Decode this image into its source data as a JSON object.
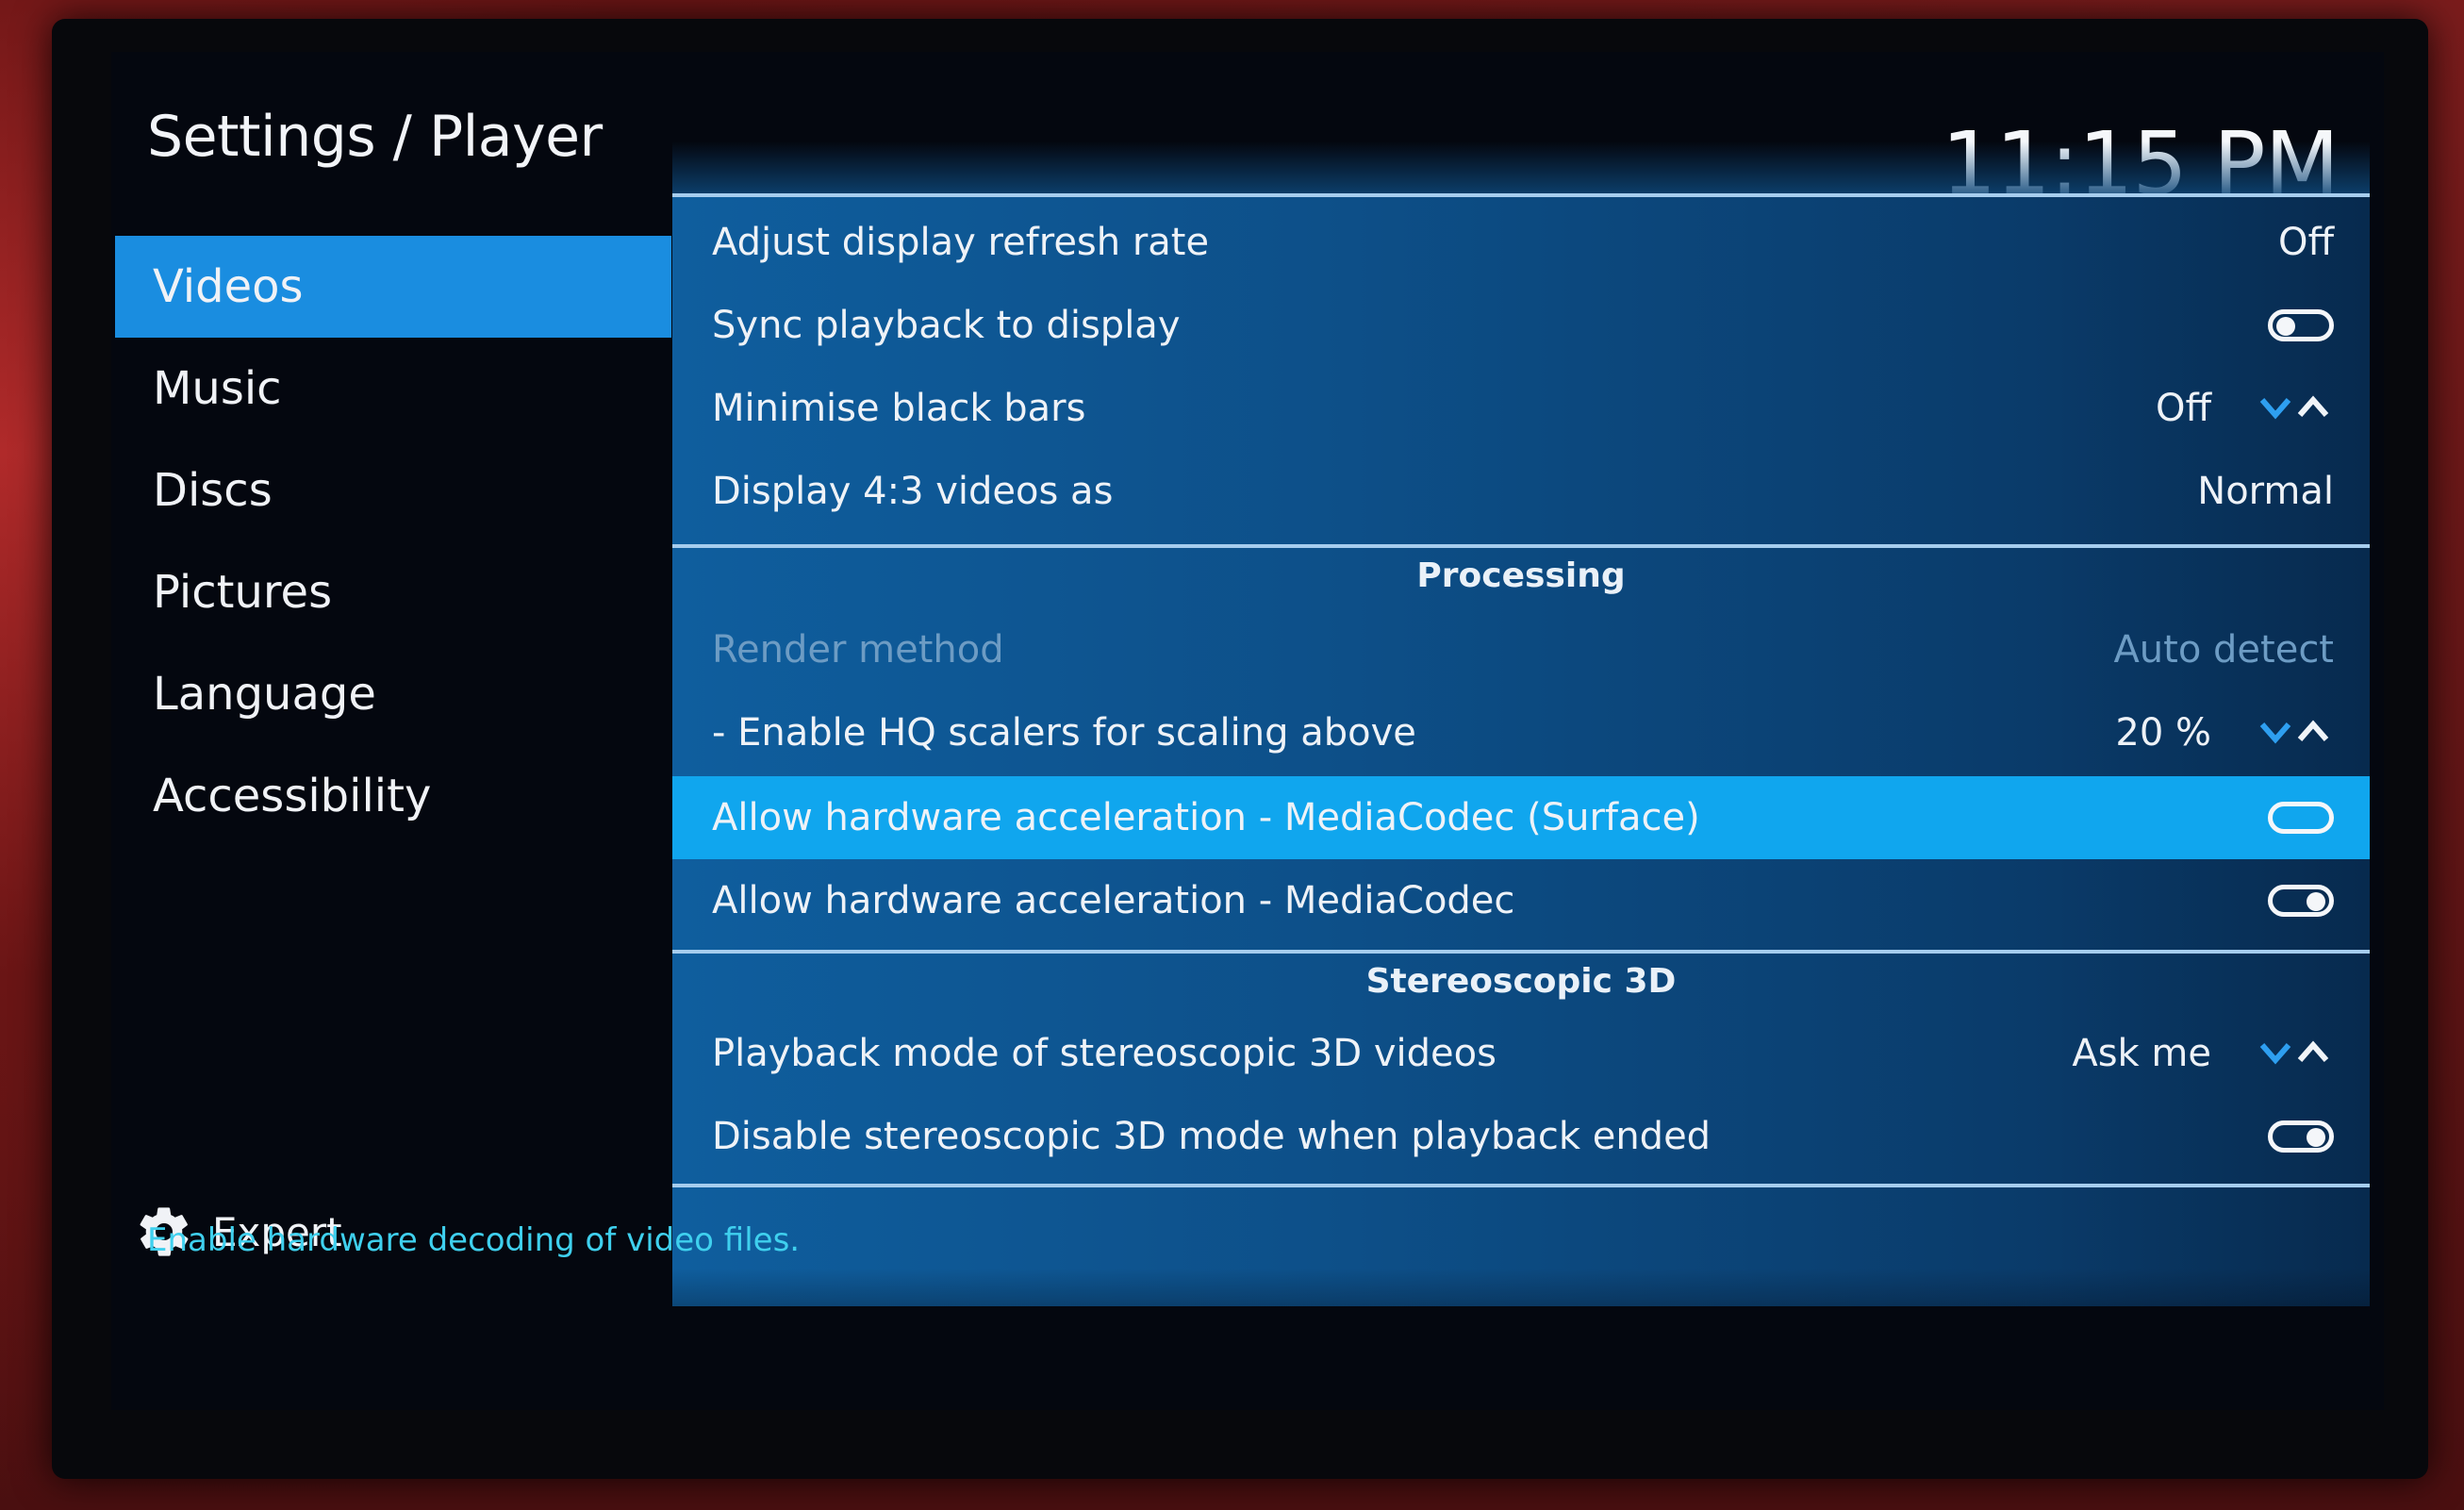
{
  "header": {
    "title": "Settings / Player",
    "clock": "11:15 PM"
  },
  "sidebar": {
    "items": [
      {
        "label": "Videos",
        "selected": true
      },
      {
        "label": "Music",
        "selected": false
      },
      {
        "label": "Discs",
        "selected": false
      },
      {
        "label": "Pictures",
        "selected": false
      },
      {
        "label": "Language",
        "selected": false
      },
      {
        "label": "Accessibility",
        "selected": false
      }
    ],
    "expert": {
      "label": "Expert",
      "icon": "gear-icon"
    }
  },
  "settings": {
    "rows": [
      {
        "label": "Adjust display refresh rate",
        "value": "Off"
      },
      {
        "label": "Sync playback to display",
        "toggle": "off"
      },
      {
        "label": "Minimise black bars",
        "value": "Off",
        "spinner": true
      },
      {
        "label": "Display 4:3 videos as",
        "value": "Normal"
      }
    ],
    "processing": {
      "header": "Processing",
      "rows": [
        {
          "label": "Render method",
          "value": "Auto detect",
          "disabled": true
        },
        {
          "label": "- Enable HQ scalers for scaling above",
          "value": "20 %",
          "spinner": true
        },
        {
          "label": "Allow hardware acceleration - MediaCodec (Surface)",
          "toggle": "off",
          "focused": true
        },
        {
          "label": "Allow hardware acceleration - MediaCodec",
          "toggle": "on"
        }
      ]
    },
    "stereoscopic": {
      "header": "Stereoscopic 3D",
      "rows": [
        {
          "label": "Playback mode of stereoscopic 3D videos",
          "value": "Ask me",
          "spinner": true
        },
        {
          "label": "Disable stereoscopic 3D mode when playback ended",
          "toggle": "on"
        }
      ]
    }
  },
  "hint": "Enable hardware decoding of video files.",
  "colors": {
    "selected": "#1a8de0",
    "focused": "#10a6ee",
    "hint": "#3fd0ee"
  }
}
